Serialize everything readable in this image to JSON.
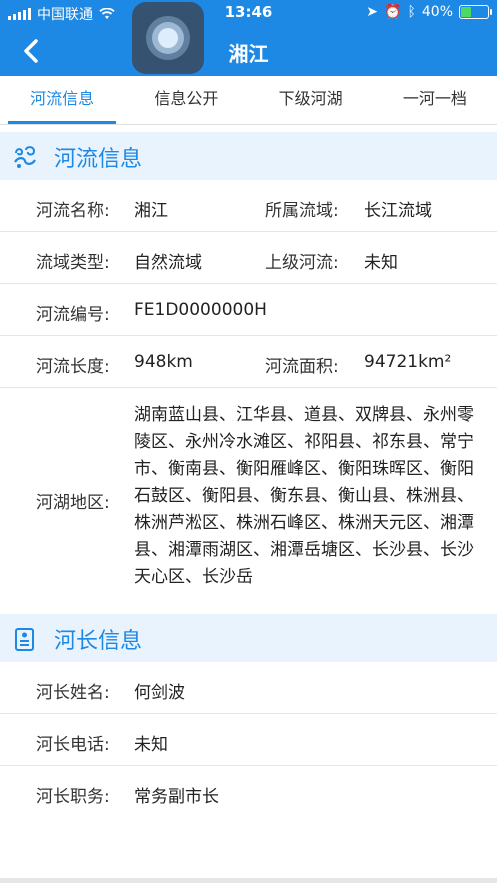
{
  "status": {
    "carrier": "中国联通",
    "time": "13:46",
    "battery": "40%",
    "battery_level": 0.4
  },
  "nav": {
    "title": "湘江"
  },
  "tabs": [
    {
      "label": "河流信息",
      "active": true
    },
    {
      "label": "信息公开",
      "active": false
    },
    {
      "label": "下级河湖",
      "active": false
    },
    {
      "label": "一河一档",
      "active": false
    }
  ],
  "river_section": {
    "title": "河流信息",
    "name_label": "河流名称:",
    "name_value": "湘江",
    "basin_label": "所属流域:",
    "basin_value": "长江流域",
    "type_label": "流域类型:",
    "type_value": "自然流域",
    "parent_label": "上级河流:",
    "parent_value": "未知",
    "code_label": "河流编号:",
    "code_value": "FE1D0000000H",
    "length_label": "河流长度:",
    "length_value": "948km",
    "area_label": "河流面积:",
    "area_value": "94721km²",
    "region_label": "河湖地区:",
    "region_value": "湖南蓝山县、江华县、道县、双牌县、永州零陵区、永州冷水滩区、祁阳县、祁东县、常宁市、衡南县、衡阳雁峰区、衡阳珠晖区、衡阳石鼓区、衡阳县、衡东县、衡山县、株洲县、株洲芦淞区、株洲石峰区、株洲天元区、湘潭县、湘潭雨湖区、湘潭岳塘区、长沙县、长沙天心区、长沙岳"
  },
  "chief_section": {
    "title": "河长信息",
    "name_label": "河长姓名:",
    "name_value": "何剑波",
    "phone_label": "河长电话:",
    "phone_value": "未知",
    "duty_label": "河长职务:",
    "duty_value": "常务副市长"
  },
  "colors": {
    "accent": "#1e88e5",
    "section_bg": "#e8f3fd"
  }
}
